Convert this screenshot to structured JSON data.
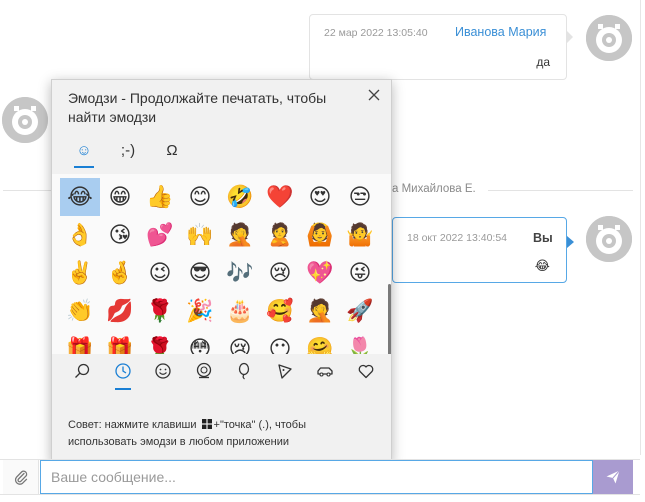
{
  "messages": [
    {
      "date": "22 мар 2022 13:05:40",
      "author": "Иванова Мария",
      "text": "да"
    },
    {
      "date": "18 окт 2022 13:40:54",
      "author": "Вы",
      "emoji": "😂"
    }
  ],
  "separator": {
    "label": "а Михайлова Е."
  },
  "emoji_panel": {
    "title": "Эмодзи - Продолжайте печатать, чтобы найти эмодзи",
    "tabs": [
      {
        "label": "☺",
        "icon": "smiley-tab-icon"
      },
      {
        "label": ";-)",
        "icon": "kaomoji-tab-icon"
      },
      {
        "label": "Ω",
        "icon": "symbols-tab-icon"
      }
    ],
    "emojis": [
      "😂",
      "😁",
      "👍",
      "😊",
      "🤣",
      "❤️",
      "😍",
      "😒",
      "👌",
      "😘",
      "💕",
      "🙌",
      "🤦",
      "🙎",
      "🙆",
      "🤷",
      "✌️",
      "🤞",
      "😉",
      "😎",
      "🎶",
      "😢",
      "💖",
      "😜",
      "👏",
      "💋",
      "🌹",
      "🎉",
      "🎂",
      "🥰",
      "🤦",
      "🚀",
      "🎁",
      "🎁",
      "🌹",
      "😳",
      "😢",
      "😶",
      "🤗",
      "🌷"
    ],
    "categories": [
      "search-icon",
      "clock-icon",
      "smiley-face-icon",
      "person-icon",
      "balloon-icon",
      "pizza-icon",
      "car-icon",
      "heart-icon"
    ],
    "tip_before": "Совет: нажмите клавиши",
    "tip_after": "+\"точка\" (.), чтобы использовать эмодзи в любом приложении"
  },
  "composer": {
    "placeholder": "Ваше сообщение..."
  },
  "colors": {
    "accent": "#3a8fd6",
    "send": "#a99bd0",
    "selected": "#a9cdf0"
  }
}
